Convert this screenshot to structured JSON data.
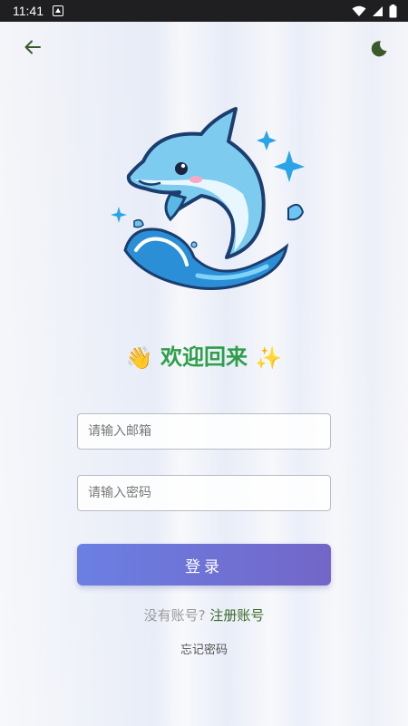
{
  "status_bar": {
    "time": "11:41"
  },
  "icons": {
    "back": "arrow-left-icon",
    "theme": "moon-icon",
    "wave": "waving-hand",
    "sparkle": "sparkles"
  },
  "welcome": {
    "wave_emoji": "👋",
    "title": "欢迎回来",
    "sparkle_emoji": "✨"
  },
  "form": {
    "email_placeholder": "请输入邮箱",
    "password_placeholder": "请输入密码",
    "login_label": "登录"
  },
  "register": {
    "prompt": "没有账号?",
    "link": "注册账号"
  },
  "forgot_label": "忘记密码",
  "colors": {
    "accent_green": "#2e9e4a",
    "button_start": "#6b7fe3",
    "button_end": "#7366c8",
    "link": "#3c6b2a"
  }
}
